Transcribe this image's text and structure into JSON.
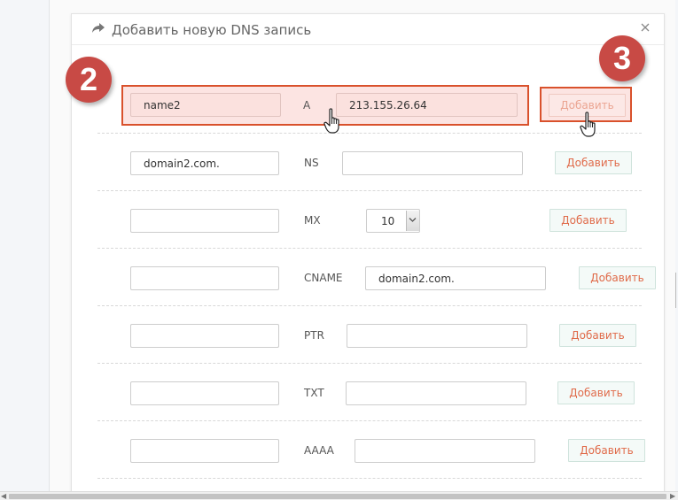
{
  "modal": {
    "title": "Добавить новую DNS запись",
    "title_icon": "share-arrow-icon",
    "close_icon": "close-icon"
  },
  "records": [
    {
      "name": "name2",
      "type": "A",
      "value": "213.155.26.64",
      "button": "Добавить"
    },
    {
      "name": "domain2.com.",
      "type": "NS",
      "value": "",
      "button": "Добавить"
    },
    {
      "name": "",
      "type": "MX",
      "priority": "10",
      "value": null,
      "button": "Добавить"
    },
    {
      "name": "",
      "type": "CNAME",
      "value": "domain2.com.",
      "button": "Добавить"
    },
    {
      "name": "",
      "type": "PTR",
      "value": "",
      "button": "Добавить"
    },
    {
      "name": "",
      "type": "TXT",
      "value": "",
      "button": "Добавить"
    },
    {
      "name": "",
      "type": "AAAA",
      "value": "",
      "button": "Добавить"
    }
  ],
  "steps": {
    "step_2": "2",
    "step_3": "3"
  },
  "colors": {
    "accent_orange": "#e06b4a",
    "badge_red": "#c84a45",
    "highlight_border": "#d9512c",
    "highlight_fill": "#fce4e2"
  }
}
